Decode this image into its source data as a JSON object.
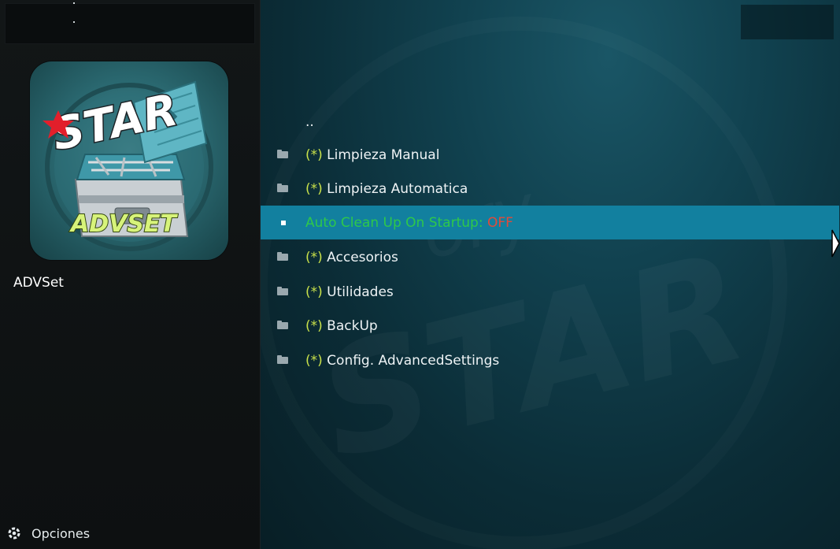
{
  "addon": {
    "name": "ADVSet",
    "logo_text_top": "STAR",
    "logo_text_bottom": "ADVSET"
  },
  "footer": {
    "options_label": "Opciones",
    "options_icon": "gear-icon"
  },
  "list": {
    "parent_label": "..",
    "items": [
      {
        "prefix": "(*)",
        "label": "Limpieza Manual",
        "icon": "folder-icon"
      },
      {
        "prefix": "(*)",
        "label": "Limpieza Automatica",
        "icon": "folder-icon"
      },
      {
        "label_main": "Auto Clean Up On Startup: ",
        "label_value": "OFF",
        "icon": "square-icon",
        "selected": true
      },
      {
        "prefix": "(*)",
        "label": "Accesorios",
        "icon": "folder-icon"
      },
      {
        "prefix": "(*)",
        "label": "Utilidades",
        "icon": "folder-icon"
      },
      {
        "prefix": "(*)",
        "label": "BackUp",
        "icon": "folder-icon"
      },
      {
        "prefix": "(*)",
        "label": "Config. AdvancedSettings",
        "icon": "folder-icon"
      }
    ]
  },
  "colors": {
    "selected_row": "#12809f",
    "prefix": "#c9e14a",
    "setting_label": "#2ec84a",
    "setting_value_off": "#e14a3a"
  }
}
